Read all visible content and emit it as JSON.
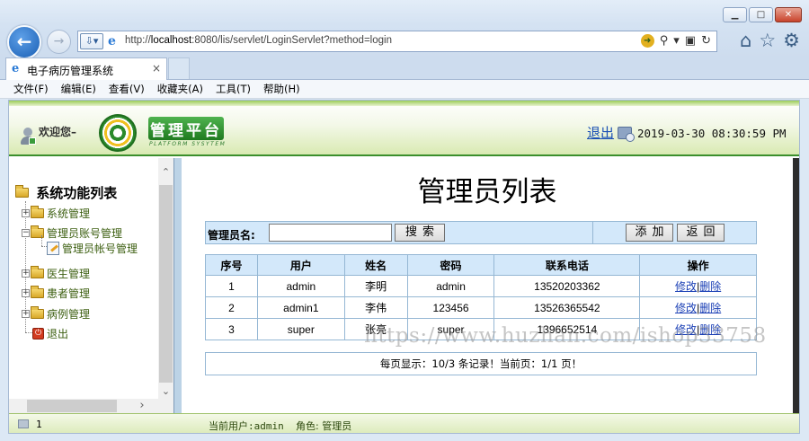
{
  "browser": {
    "url_prefix": "http://",
    "url_host": "localhost",
    "url_rest": ":8080/lis/servlet/LoginServlet?method=login",
    "tab_title": "电子病历管理系统",
    "tab_close": "×",
    "menu": [
      "文件(F)",
      "编辑(E)",
      "查看(V)",
      "收藏夹(A)",
      "工具(T)",
      "帮助(H)"
    ]
  },
  "header": {
    "welcome": "欢迎您–",
    "logo_title": "管理平台",
    "logo_sub": "PLATFORM SYSYTEM",
    "logout": "退出",
    "datetime": "2019-03-30 08:30:59 PM"
  },
  "sidebar": {
    "root": "系统功能列表",
    "items": [
      {
        "label": "系统管理"
      },
      {
        "label": "管理员账号管理"
      },
      {
        "label": "管理员帐号管理"
      },
      {
        "label": "医生管理"
      },
      {
        "label": "患者管理"
      },
      {
        "label": "病例管理"
      },
      {
        "label": "退出"
      }
    ]
  },
  "main": {
    "title": "管理员列表",
    "search_label": "管理员名:",
    "search_value": "",
    "search_button": "搜索",
    "add_button": "添加",
    "back_button": "返回",
    "columns": [
      "序号",
      "用户",
      "姓名",
      "密码",
      "联系电话",
      "操作"
    ],
    "rows": [
      {
        "no": "1",
        "user": "admin",
        "name": "李明",
        "password": "admin",
        "phone": "13520203362",
        "edit": "修改",
        "delete": "删除"
      },
      {
        "no": "2",
        "user": "admin1",
        "name": "李伟",
        "password": "123456",
        "phone": "13526365542",
        "edit": "修改",
        "delete": "删除"
      },
      {
        "no": "3",
        "user": "super",
        "name": "张亮",
        "password": "super",
        "phone": "1396652514",
        "edit": "修改",
        "delete": "删除"
      }
    ],
    "separator": "|",
    "pager": "每页显示：10/3 条记录！当前页：1/1 页！"
  },
  "footer": {
    "count": "1",
    "current_user": "当前用户:admin",
    "role": "角色: 管理员"
  },
  "watermark": "https://www.huzhan.com/ishop33758"
}
